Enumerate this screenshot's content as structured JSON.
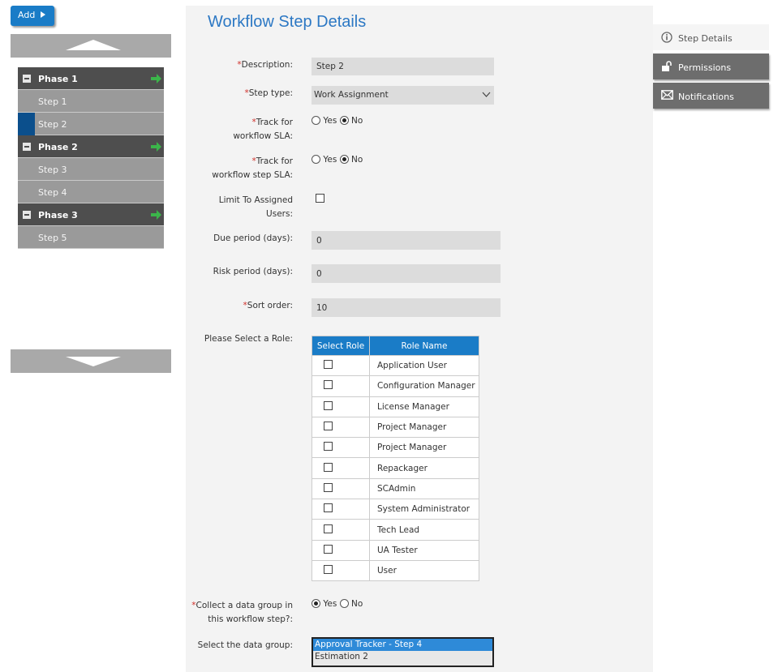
{
  "toolbar": {
    "add_label": "Add"
  },
  "tree": {
    "rows": [
      {
        "kind": "phase",
        "label": "Phase 1"
      },
      {
        "kind": "step",
        "label": "Step 1"
      },
      {
        "kind": "step",
        "label": "Step 2",
        "selected": true
      },
      {
        "kind": "phase",
        "label": "Phase 2"
      },
      {
        "kind": "step",
        "label": "Step 3"
      },
      {
        "kind": "step",
        "label": "Step 4"
      },
      {
        "kind": "phase",
        "label": "Phase 3"
      },
      {
        "kind": "step",
        "label": "Step 5"
      }
    ]
  },
  "main": {
    "title": "Workflow Step Details",
    "description": {
      "label": "Description:",
      "value": "Step 2"
    },
    "step_type": {
      "label": "Step type:",
      "value": "Work Assignment"
    },
    "track_sla": {
      "label": "Track for workflow SLA:",
      "yes": "Yes",
      "no": "No",
      "selected": "No"
    },
    "track_step_sla": {
      "label": "Track for workflow step SLA:",
      "yes": "Yes",
      "no": "No",
      "selected": "No"
    },
    "limit_assigned": {
      "label": "Limit To Assigned Users:",
      "checked": false
    },
    "due_period": {
      "label": "Due period (days):",
      "value": "0"
    },
    "risk_period": {
      "label": "Risk period (days):",
      "value": "0"
    },
    "sort_order": {
      "label": "Sort order:",
      "value": "10"
    },
    "role_prompt": "Please Select a Role:",
    "role_table": {
      "headers": [
        "Select Role",
        "Role Name"
      ],
      "rows": [
        "Application User",
        "Configuration Manager",
        "License Manager",
        "Project Manager",
        "Project Manager",
        "Repackager",
        "SCAdmin",
        "System Administrator",
        "Tech Lead",
        "UA Tester",
        "User"
      ]
    },
    "collect_group": {
      "label": "Collect a data group in this workflow step?:",
      "yes": "Yes",
      "no": "No",
      "selected": "Yes"
    },
    "data_group": {
      "label": "Select the data group:",
      "options": [
        "Approval Tracker - Step 4",
        "Estimation 2"
      ],
      "selected": "Approval Tracker - Step 4"
    }
  },
  "tabs": [
    {
      "label": "Step Details",
      "icon": "info-icon",
      "active": true
    },
    {
      "label": "Permissions",
      "icon": "unlock-icon",
      "active": false
    },
    {
      "label": "Notifications",
      "icon": "envelope-icon",
      "active": false
    }
  ],
  "colors": {
    "accent": "#1a7cc7",
    "title": "#2c78c4",
    "required": "#d0302a",
    "phase_bg": "#4e4e4e",
    "step_bg": "#9a9a9a",
    "go_arrow": "#3bb54a"
  }
}
